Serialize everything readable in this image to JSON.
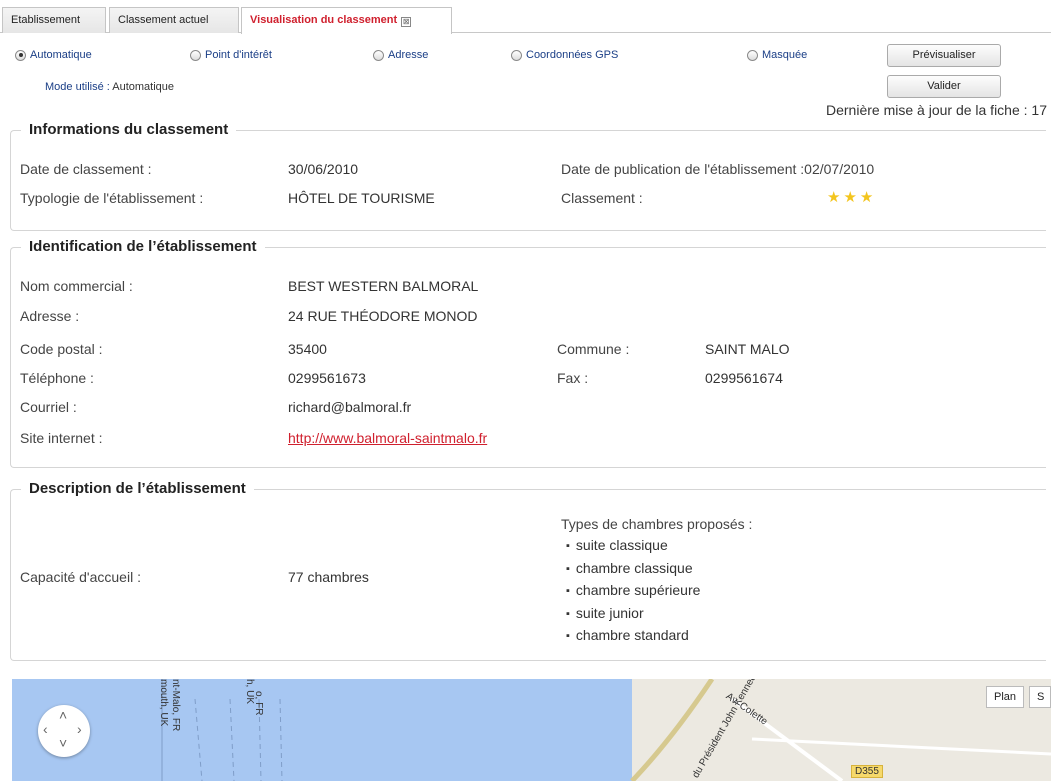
{
  "tabs": [
    {
      "label": "Etablissement"
    },
    {
      "label": "Classement actuel"
    },
    {
      "label": "Visualisation du classement",
      "close": "⊠"
    }
  ],
  "radios": [
    {
      "label": "Automatique",
      "selected": true
    },
    {
      "label": "Point d'intérêt",
      "selected": false
    },
    {
      "label": "Adresse",
      "selected": false
    },
    {
      "label": "Coordonnées GPS",
      "selected": false
    },
    {
      "label": "Masquée",
      "selected": false
    }
  ],
  "buttons": {
    "preview": "Prévisualiser",
    "validate": "Valider"
  },
  "mode": {
    "label": "Mode utilisé :",
    "value": "Automatique"
  },
  "last_update": "Dernière mise à jour de la fiche : 17",
  "classement": {
    "title": "Informations du classement",
    "date_label": "Date de classement :",
    "date_value": "30/06/2010",
    "publication": "Date de publication de l'établissement :02/07/2010",
    "typology_label": "Typologie de l'établissement :",
    "typology_value": "HÔTEL DE TOURISME",
    "rank_label": "Classement :",
    "stars": "★★★"
  },
  "identification": {
    "title": "Identification de l’établissement",
    "name_label": "Nom commercial :",
    "name_value": "BEST WESTERN BALMORAL",
    "address_label": "Adresse :",
    "address_value": "24 RUE THÉODORE MONOD",
    "postal_label": "Code postal :",
    "postal_value": "35400",
    "commune_label": "Commune :",
    "commune_value": "SAINT MALO",
    "phone_label": "Téléphone :",
    "phone_value": "0299561673",
    "fax_label": "Fax :",
    "fax_value": "0299561674",
    "email_label": "Courriel :",
    "email_value": "richard@balmoral.fr",
    "site_label": "Site internet :",
    "site_value": "http://www.balmoral-saintmalo.fr"
  },
  "description": {
    "title": "Description de l’établissement",
    "capacity_label": "Capacité d'accueil :",
    "capacity_value": "77 chambres",
    "room_types_label": "Types de chambres proposés :",
    "room_types": [
      "suite classique",
      "chambre classique",
      "chambre supérieure",
      "suite junior",
      "chambre standard"
    ]
  },
  "map": {
    "plan_label": "Plan",
    "sat_label": "S",
    "road_label": "D355",
    "labels": [
      "nt-Malo, FR",
      "mouth, UK",
      "h, UK",
      "o, FR",
      "du Président John Kennedy",
      "Av. Colette"
    ]
  },
  "colors": {
    "accent": "#d0202e",
    "label_blue": "#1a3e86",
    "star": "#f3c51e",
    "sea": "#a7c7f2",
    "land": "#ece9e1"
  }
}
